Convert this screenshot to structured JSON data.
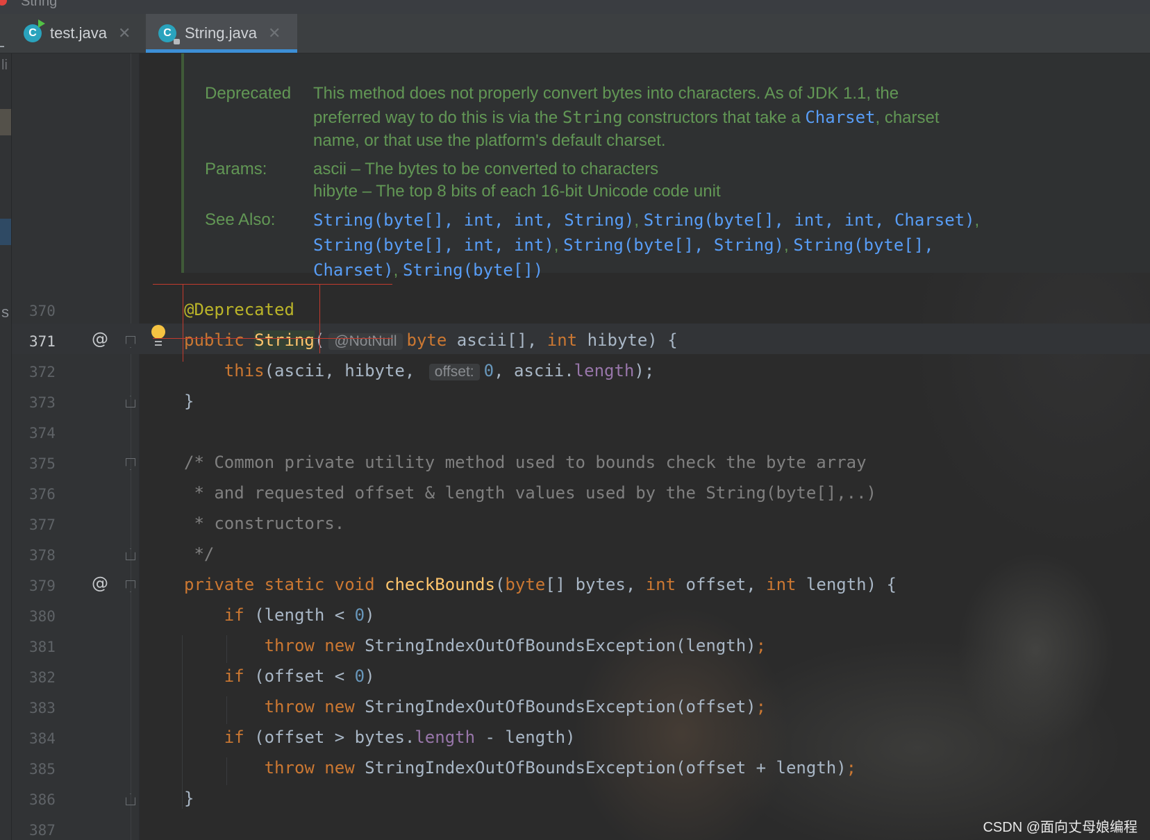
{
  "window": {
    "title": "String"
  },
  "tabs": [
    {
      "label": "test.java",
      "active": false
    },
    {
      "label": "String.java",
      "active": true
    }
  ],
  "left_strip": {
    "top_char": "li",
    "lower_char": "s"
  },
  "doc": {
    "deprecated_label": "Deprecated",
    "deprecated_lines": [
      "This method does not properly convert bytes into characters. As of JDK 1.1, the",
      "preferred way to do this is via the ",
      "String",
      " constructors that take a ",
      "Charset",
      ", charset",
      "name, or that use the platform's default charset."
    ],
    "params_label": "Params:",
    "params": [
      "ascii – The bytes to be converted to characters",
      "hibyte – The top 8 bits of each 16-bit Unicode code unit"
    ],
    "see_also_label": "See Also:",
    "see_also_links": [
      "String(byte[], int, int, String)",
      "String(byte[], int, int, Charset)",
      "String(byte[], int, int)",
      "String(byte[], String)",
      "String(byte[],",
      "Charset)",
      "String(byte[])"
    ]
  },
  "line_numbers": [
    "370",
    "371",
    "372",
    "373",
    "374",
    "375",
    "376",
    "377",
    "378",
    "379",
    "380",
    "381",
    "382",
    "383",
    "384",
    "385",
    "386",
    "387"
  ],
  "code": {
    "l370": "@Deprecated",
    "l371_kw": "public",
    "l371_fn": "String",
    "l371_hint": "@NotNull",
    "l371_type": "byte",
    "l371_rest1": " ascii[], ",
    "l371_int": "int",
    "l371_rest2": " hibyte) {",
    "l372_this": "this",
    "l372_a": "(ascii, hibyte,",
    "l372_hint": "offset:",
    "l372_zero": "0",
    "l372_b": ", ascii.",
    "l372_len": "length",
    "l372_c": ");",
    "l373": "}",
    "l375": "/* Common private utility method used to bounds check the byte array",
    "l376": " * and requested offset & length values used by the String(byte[],..)",
    "l377": " * constructors.",
    "l378": " */",
    "l379_priv": "private",
    "l379_static": "static",
    "l379_void": "void",
    "l379_fn": "checkBounds",
    "l379_byte": "byte",
    "l379_a": "[] bytes, ",
    "l379_int1": "int",
    "l379_b": " offset, ",
    "l379_int2": "int",
    "l379_c": " length) {",
    "if": "if",
    "l380_a": " (length < ",
    "l380_zero": "0",
    "l380_b": ")",
    "throw": "throw",
    "new": "new",
    "l381_a": " StringIndexOutOfBoundsException(length)",
    "semi": ";",
    "l382_a": " (offset < ",
    "l382_zero": "0",
    "l382_b": ")",
    "l383_a": " StringIndexOutOfBoundsException(offset)",
    "l384_a": " (offset > bytes.",
    "l384_len": "length",
    "l384_b": " - length)",
    "l385_a": " StringIndexOutOfBoundsException(offset + length)",
    "l386": "}"
  },
  "watermark": "CSDN @面向丈母娘编程",
  "colors": {
    "keyword": "#cc7832",
    "annotation": "#bbb529",
    "function": "#ffc66d",
    "number": "#6897bb",
    "field": "#9876aa",
    "comment": "#808080",
    "doc_text": "#629755",
    "doc_link": "#589df6",
    "tab_underline": "#3d8fd6"
  }
}
